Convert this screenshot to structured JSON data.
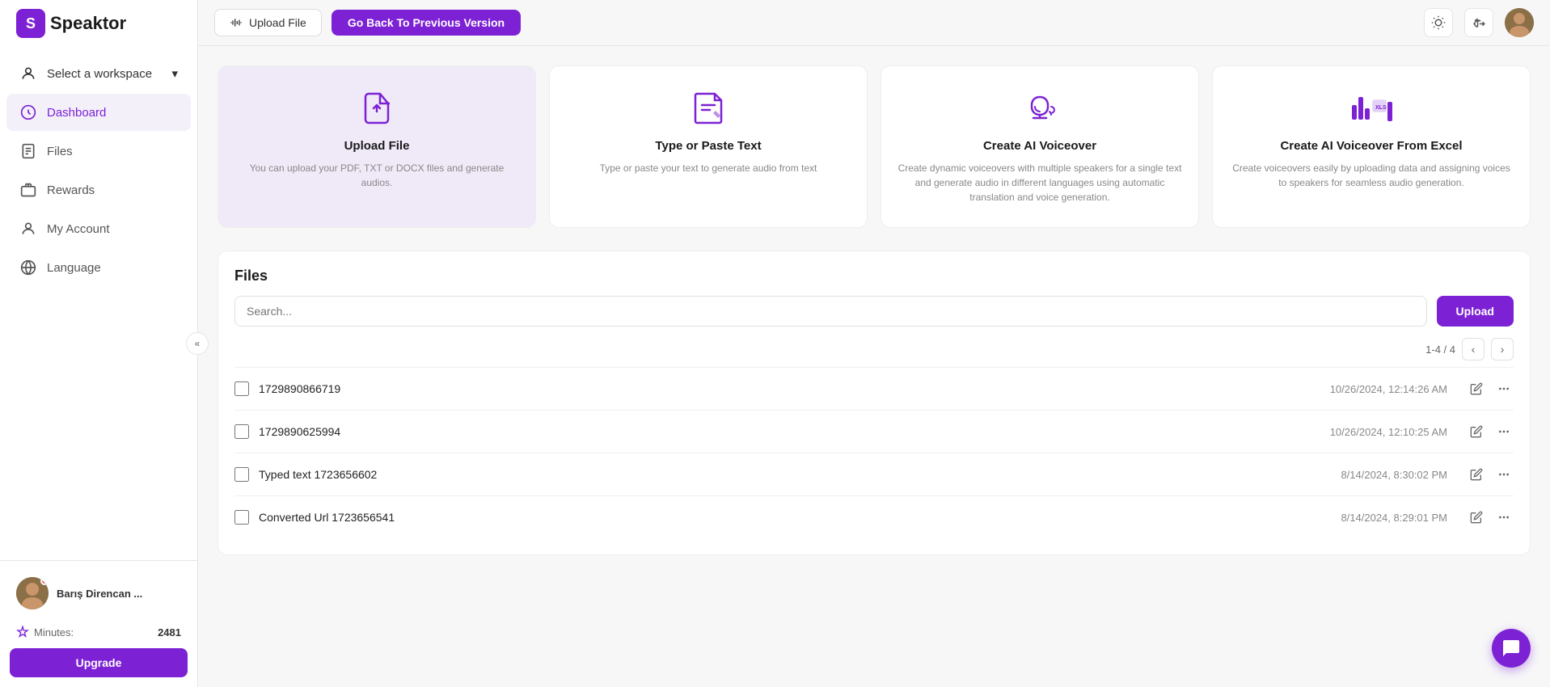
{
  "logo": {
    "icon": "S",
    "text": "Speaktor"
  },
  "sidebar": {
    "workspace_label": "Select a workspace",
    "nav_items": [
      {
        "id": "dashboard",
        "label": "Dashboard",
        "active": true
      },
      {
        "id": "files",
        "label": "Files",
        "active": false
      },
      {
        "id": "rewards",
        "label": "Rewards",
        "active": false
      },
      {
        "id": "my-account",
        "label": "My Account",
        "active": false
      },
      {
        "id": "language",
        "label": "Language",
        "active": false
      }
    ],
    "user": {
      "name": "Barış Direncan ...",
      "minutes_label": "Minutes:",
      "minutes_value": "2481"
    },
    "upgrade_label": "Upgrade"
  },
  "topbar": {
    "upload_file_label": "Upload File",
    "go_back_label": "Go Back To Previous Version"
  },
  "cards": [
    {
      "id": "upload-file",
      "title": "Upload File",
      "desc": "You can upload your PDF, TXT or DOCX files and generate audios."
    },
    {
      "id": "type-paste",
      "title": "Type or Paste Text",
      "desc": "Type or paste your text to generate audio from text"
    },
    {
      "id": "ai-voiceover",
      "title": "Create AI Voiceover",
      "desc": "Create dynamic voiceovers with multiple speakers for a single text and generate audio in different languages using automatic translation and voice generation."
    },
    {
      "id": "ai-voiceover-excel",
      "title": "Create AI Voiceover From Excel",
      "desc": "Create voiceovers easily by uploading data and assigning voices to speakers for seamless audio generation."
    }
  ],
  "files_section": {
    "title": "Files",
    "search_placeholder": "Search...",
    "upload_label": "Upload",
    "pagination": "1-4 / 4",
    "files": [
      {
        "name": "1729890866719",
        "date": "10/26/2024, 12:14:26 AM"
      },
      {
        "name": "1729890625994",
        "date": "10/26/2024, 12:10:25 AM"
      },
      {
        "name": "Typed text 1723656602",
        "date": "8/14/2024, 8:30:02 PM"
      },
      {
        "name": "Converted Url 1723656541",
        "date": "8/14/2024, 8:29:01 PM"
      }
    ]
  }
}
